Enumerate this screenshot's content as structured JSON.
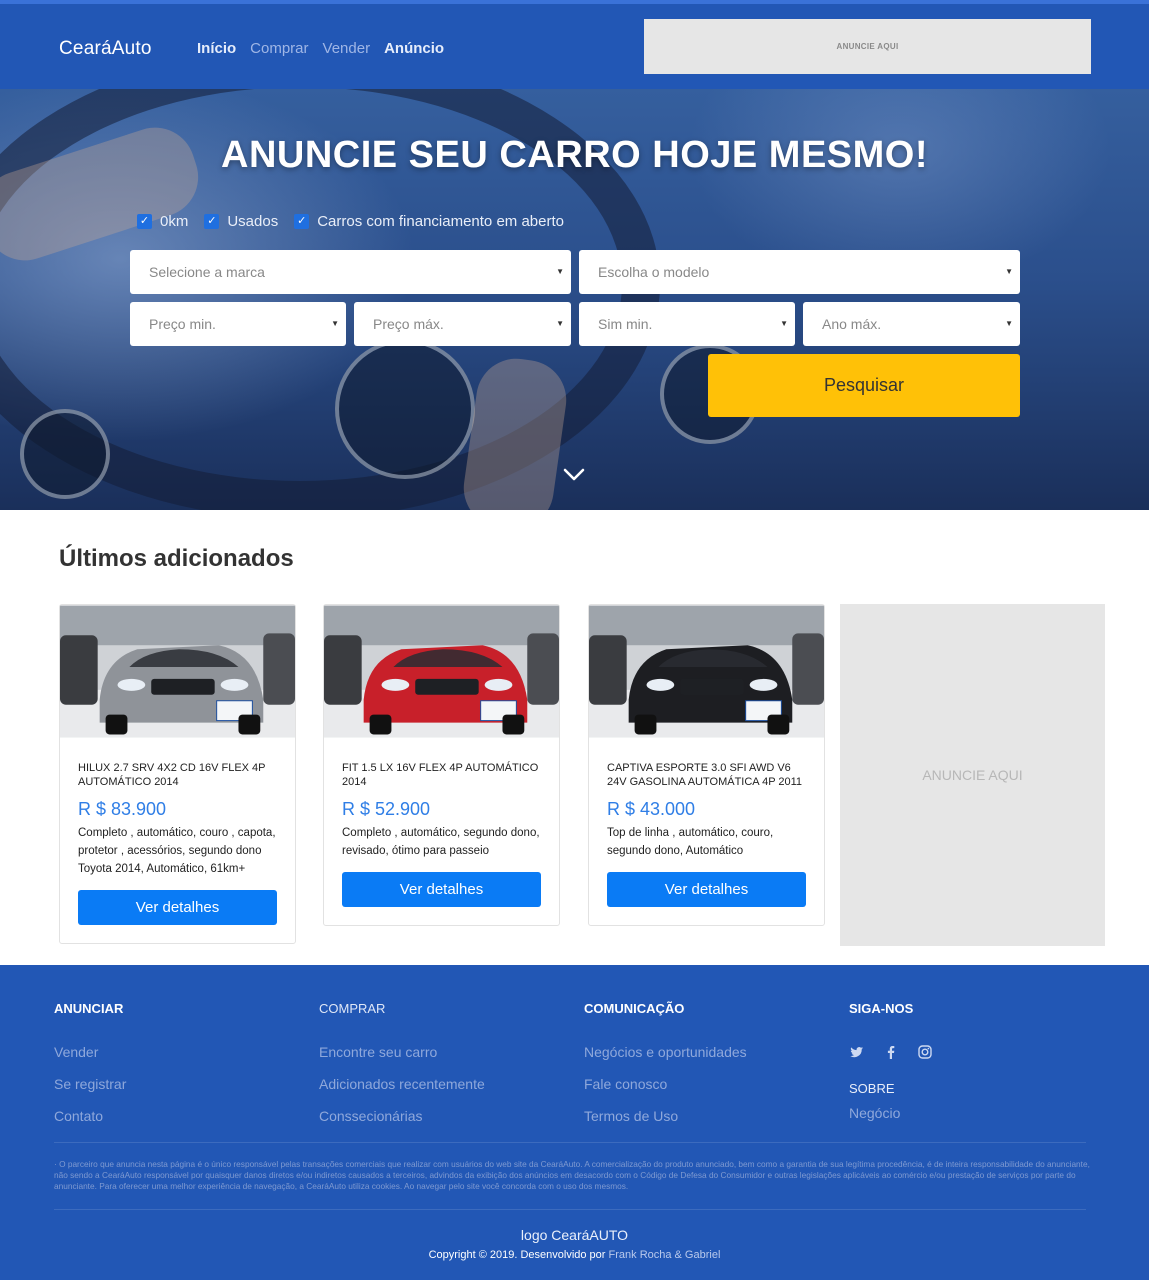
{
  "header": {
    "brand": "CearáAuto",
    "nav": [
      "Início",
      "Comprar",
      "Vender",
      "Anúncio"
    ],
    "ad_banner": "ANUNCIE AQUI"
  },
  "hero": {
    "title": "ANUNCIE SEU CARRO HOJE MESMO!",
    "checkboxes": [
      {
        "label": "0km",
        "checked": true
      },
      {
        "label": "Usados",
        "checked": true
      },
      {
        "label": "Carros com financiamento em aberto",
        "checked": true
      }
    ],
    "selects": {
      "brand": "Selecione a marca",
      "model": "Escolha o modelo",
      "price_min": "Preço min.",
      "price_max": "Preço máx.",
      "year_min": "Sim min.",
      "year_max": "Ano máx."
    },
    "search_button": "Pesquisar"
  },
  "latest": {
    "title": "Últimos adicionados",
    "cards": [
      {
        "title": "HILUX 2.7 SRV 4X2 CD 16V FLEX 4P AUTOMÁTICO 2014",
        "price": "R $ 83.900",
        "description": "Completo , automático, couro , capota, protetor , acessórios, segundo dono Toyota 2014, Automático, 61km+",
        "button": "Ver detalhes",
        "car_color": "#8f9399"
      },
      {
        "title": "FIT 1.5 LX 16V FLEX 4P AUTOMÁTICO 2014",
        "price": "R $ 52.900",
        "description": "Completo , automático, segundo dono, revisado, ótimo para passeio",
        "button": "Ver detalhes",
        "car_color": "#c8202a"
      },
      {
        "title": "CAPTIVA ESPORTE 3.0 SFI AWD V6 24V GASOLINA AUTOMÁTICA 4P 2011",
        "price": "R $ 43.000",
        "description": "Top de linha , automático, couro, segundo dono, Automático",
        "button": "Ver detalhes",
        "car_color": "#1d1e22"
      }
    ],
    "ad_box": "ANUNCIE AQUI"
  },
  "footer": {
    "columns": [
      {
        "heading": "ANUNCIAR",
        "links": [
          "Vender",
          "Se registrar",
          "Contato"
        ]
      },
      {
        "heading": "COMPRAR",
        "links": [
          "Encontre seu carro",
          "Adicionados recentemente",
          "Conssecionárias"
        ]
      },
      {
        "heading": "COMUNICAÇÃO",
        "links": [
          "Negócios e oportunidades",
          "Fale conosco",
          "Termos de Uso"
        ]
      }
    ],
    "follow": {
      "heading": "SIGA-NOS",
      "icons": [
        "twitter-icon",
        "facebook-icon",
        "instagram-icon"
      ],
      "about_heading": "SOBRE",
      "about_link": "Negócio"
    },
    "disclaimer": "· O parceiro que anuncia nesta página é o único responsável pelas transações comerciais que realizar com usuários do web site da CearáAuto. A comercialização do produto anunciado, bem como a garantia de sua legítima procedência, é de inteira responsabilidade do anunciante, não sendo a CearáAuto responsável por quaisquer danos diretos e/ou indiretos causados a terceiros, advindos da exibição dos anúncios em desacordo com o Código de Defesa do Consumidor e outras legislações aplicáveis ao comércio e/ou prestação de serviços por parte do anunciante. Para oferecer uma melhor experiência de navegação, a CearáAuto utiliza cookies. Ao navegar pelo site você concorda com o uso dos mesmos.",
    "logo_text": "logo CearáAUTO",
    "copyright": "Copyright © 2019. Desenvolvido por",
    "authors": "Frank Rocha & Gabriel"
  },
  "colors": {
    "primary_blue": "#2257b5",
    "button_blue": "#0a7bf5",
    "search_yellow": "#ffc107",
    "price_blue": "#2f7ee6"
  }
}
